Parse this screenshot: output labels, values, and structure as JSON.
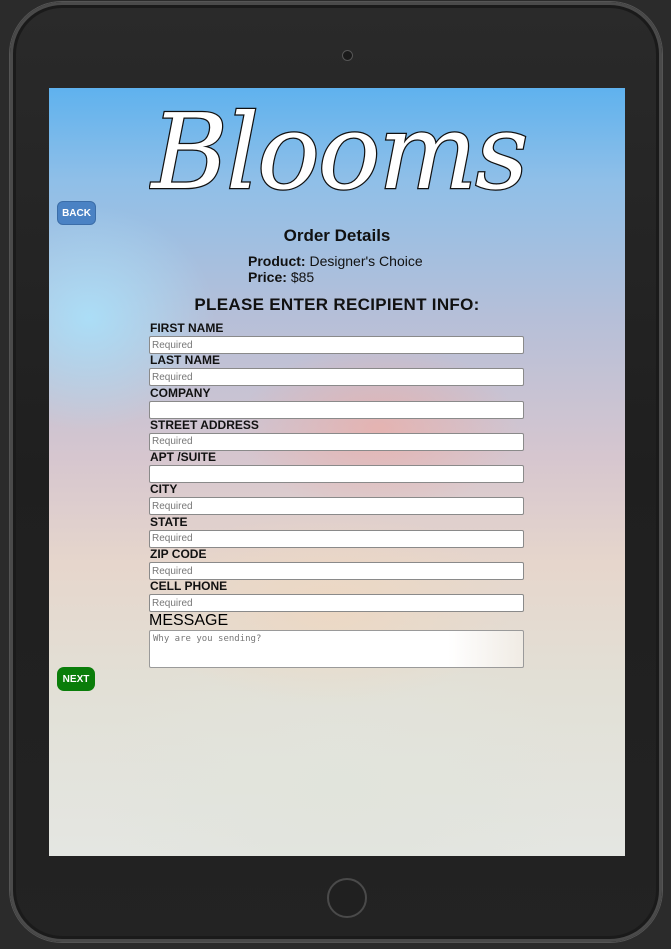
{
  "brand": {
    "logo_text": "Blooms"
  },
  "nav": {
    "back_label": "BACK",
    "next_label": "NEXT"
  },
  "order": {
    "title": "Order Details",
    "product_label": "Product:",
    "product_value": "Designer's Choice",
    "price_label": "Price:",
    "price_value": "$85"
  },
  "form": {
    "heading": "PLEASE ENTER RECIPIENT INFO:",
    "fields": [
      {
        "label": "FIRST NAME",
        "placeholder": "Required",
        "value": ""
      },
      {
        "label": "LAST NAME",
        "placeholder": "Required",
        "value": ""
      },
      {
        "label": "COMPANY",
        "placeholder": "",
        "value": ""
      },
      {
        "label": "STREET ADDRESS",
        "placeholder": "Required",
        "value": ""
      },
      {
        "label": "APT /SUITE",
        "placeholder": "",
        "value": ""
      },
      {
        "label": "CITY",
        "placeholder": "Required",
        "value": ""
      },
      {
        "label": "STATE",
        "placeholder": "Required",
        "value": ""
      },
      {
        "label": "ZIP CODE",
        "placeholder": "Required",
        "value": ""
      },
      {
        "label": "CELL PHONE",
        "placeholder": "Required",
        "value": ""
      }
    ],
    "message": {
      "label": "MESSAGE",
      "placeholder": "Why are you sending?",
      "value": ""
    }
  },
  "colors": {
    "back_button": "#4a82c4",
    "next_button": "#0a7d0a",
    "device_frame": "#232323"
  }
}
